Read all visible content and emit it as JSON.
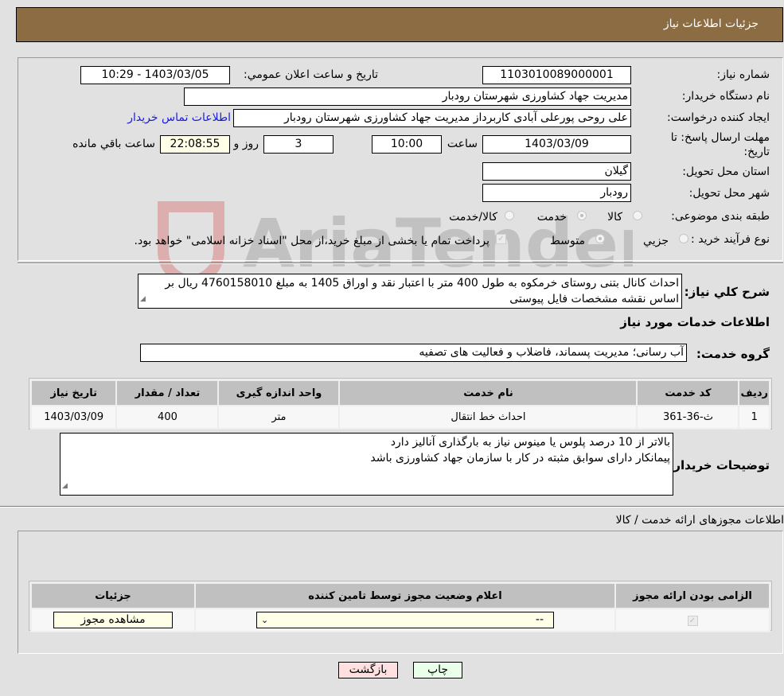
{
  "header": {
    "title": "جزئیات اطلاعات نیاز"
  },
  "form": {
    "need_number_label": "شماره نیاز:",
    "need_number": "1103010089000001",
    "announce_label": "تاریخ و ساعت اعلان عمومي:",
    "announce_value": "1403/03/05 - 10:29",
    "buyer_org_label": "نام دستگاه خریدار:",
    "buyer_org": "مدیریت جهاد کشاورزی شهرستان رودبار",
    "creator_label": "ایجاد کننده درخواست:",
    "creator": "علی روحی پورعلی آبادی کاربرداز مدیریت جهاد کشاورزی شهرستان رودبار",
    "contact_link": "اطلاعات تماس خریدار",
    "deadline_label_1": "مهلت ارسال پاسخ: تا",
    "deadline_label_2": "تاریخ:",
    "deadline_date": "1403/03/09",
    "time_label": "ساعت",
    "deadline_time": "10:00",
    "days_value": "3",
    "days_label": "روز و",
    "remaining_time": "22:08:55",
    "remaining_label": "ساعت باقي مانده",
    "province_label": "استان محل تحویل:",
    "province": "گیلان",
    "city_label": "شهر محل تحویل:",
    "city": "رودبار",
    "category_label": "طبقه بندی موضوعی:",
    "category_options": [
      {
        "label": "کالا",
        "checked": false
      },
      {
        "label": "خدمت",
        "checked": true
      },
      {
        "label": "کالا/خدمت",
        "checked": false
      }
    ],
    "process_label": "نوع فرآیند خرید :",
    "process_options": [
      {
        "label": "جزيي",
        "checked": false
      },
      {
        "label": "متوسط",
        "checked": true
      }
    ],
    "treasury_checkbox_checked": true,
    "treasury_text": "پرداخت تمام یا بخشی از مبلغ خرید،از محل \"اسناد خزانه اسلامی\" خواهد بود."
  },
  "description": {
    "label": "شرح کلي نیاز:",
    "text": "احداث کانال بتنی روستای خرمکوه به طول 400 متر با اعتبار نقد و اوراق 1405 به مبلغ 4760158010 ریال بر اساس نقشه مشخصات فایل پیوستی"
  },
  "services": {
    "section_title": "اطلاعات خدمات مورد نیاز",
    "group_label": "گروه خدمت:",
    "group_value": "آب رسانی؛ مدیریت پسماند، فاضلاب و فعالیت های تصفیه",
    "table": {
      "headers": [
        "ردیف",
        "کد خدمت",
        "نام خدمت",
        "واحد اندازه گیری",
        "تعداد / مقدار",
        "تاریخ نیاز"
      ],
      "rows": [
        [
          "1",
          "ث-36-361",
          "احداث خط انتقال",
          "متر",
          "400",
          "1403/03/09"
        ]
      ]
    }
  },
  "buyer_notes": {
    "label": "توضیحات خریدار:",
    "line1": "بالاتر از 10 درصد پلوس یا مینوس نیاز به بارگذاری آنالیز دارد",
    "line2": "پیمانکار دارای سوابق مثبته در کار با سازمان جهاد کشاورزی باشد"
  },
  "permits": {
    "section_title": "اطلاعات مجوزهای ارائه خدمت / کالا",
    "headers": [
      "الزامی بودن ارائه مجوز",
      "اعلام وضعیت مجوز توسط تامین کننده",
      "جزئیات"
    ],
    "row": {
      "required_checked": true,
      "status_selected": "--",
      "view_button": "مشاهده مجوز"
    }
  },
  "buttons": {
    "back": "بازگشت",
    "print": "چاپ"
  },
  "colors": {
    "header_bg": "#8c6d43",
    "back_bg": "#ffe0e0",
    "print_bg": "#eaffea",
    "link": "#1a1adc"
  }
}
